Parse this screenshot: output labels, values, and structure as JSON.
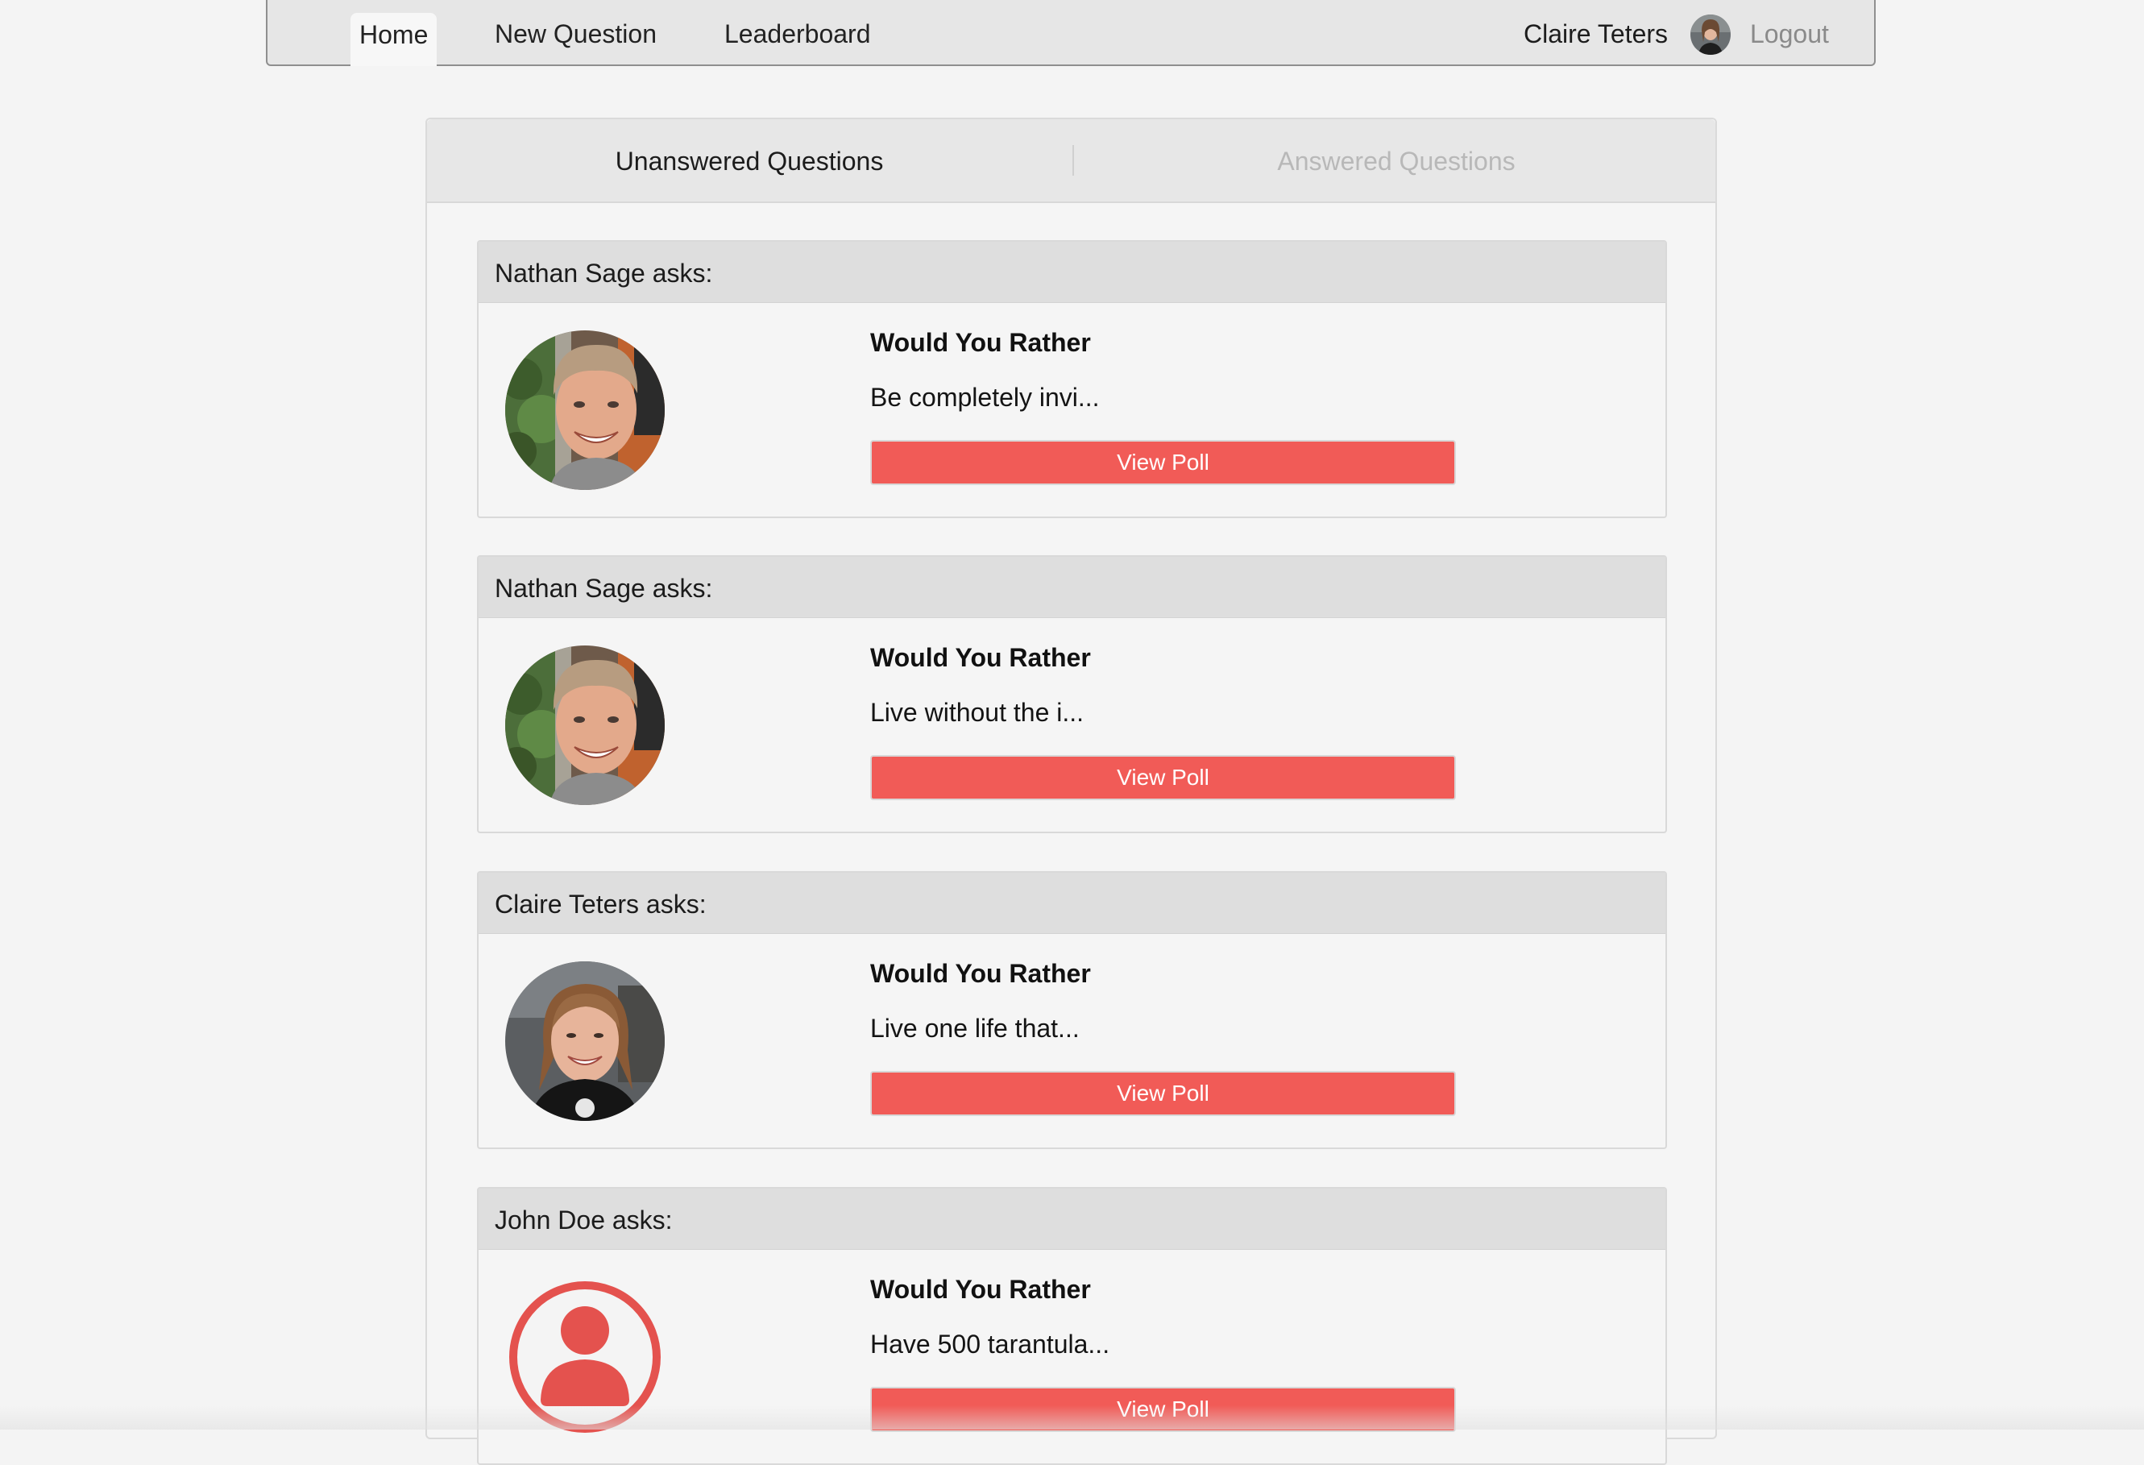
{
  "nav": {
    "home": "Home",
    "new_question": "New Question",
    "leaderboard": "Leaderboard",
    "user_name": "Claire Teters",
    "logout": "Logout"
  },
  "tabs": {
    "unanswered": "Unanswered Questions",
    "answered": "Answered Questions"
  },
  "questions": [
    {
      "asker": "Nathan Sage asks:",
      "title": "Would You Rather",
      "snippet": "Be completely invi...",
      "button": "View Poll",
      "avatar": "nathan-sage-avatar"
    },
    {
      "asker": "Nathan Sage asks:",
      "title": "Would You Rather",
      "snippet": "Live without the i...",
      "button": "View Poll",
      "avatar": "nathan-sage-avatar"
    },
    {
      "asker": "Claire Teters asks:",
      "title": "Would You Rather",
      "snippet": "Live one life that...",
      "button": "View Poll",
      "avatar": "claire-teters-avatar"
    },
    {
      "asker": "John Doe asks:",
      "title": "Would You Rather",
      "snippet": "Have 500 tarantula...",
      "button": "View Poll",
      "avatar": "default-user-icon"
    }
  ],
  "colors": {
    "accent": "#f15b57",
    "nav_background": "#e6e6e6",
    "page_background": "#f4f4f4",
    "card_header": "#dedede"
  }
}
